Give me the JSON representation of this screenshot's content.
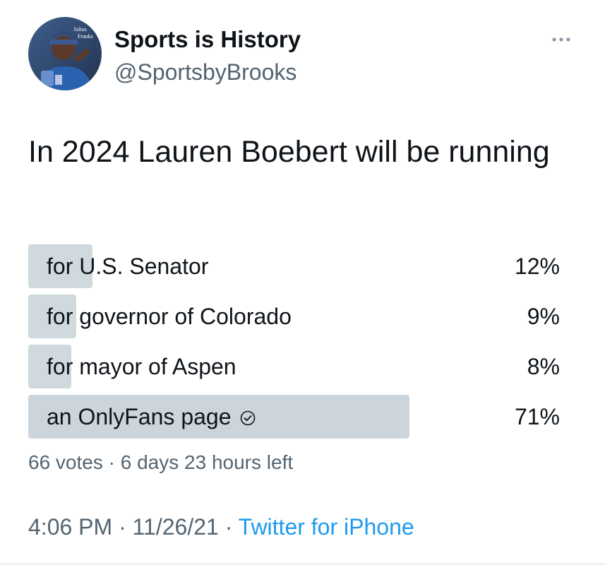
{
  "tweet": {
    "display_name": "Sports is History",
    "handle": "@SportsbyBrooks",
    "avatar_caption": "Julius Franks",
    "text": "In 2024 Lauren Boebert will be running",
    "more_icon": "ellipsis-icon"
  },
  "poll": {
    "options": [
      {
        "label": "for U.S. Senator",
        "percent_text": "12%",
        "share": 0.12,
        "winner": false
      },
      {
        "label": "for governor of Colorado",
        "percent_text": "9%",
        "share": 0.09,
        "winner": false
      },
      {
        "label": "for mayor of Aspen",
        "percent_text": "8%",
        "share": 0.08,
        "winner": false
      },
      {
        "label": "an OnlyFans page",
        "percent_text": "71%",
        "share": 0.71,
        "winner": true,
        "icon": "check-circle-icon"
      }
    ],
    "votes": "66 votes",
    "separator": " · ",
    "time_left": "6 days 23 hours left"
  },
  "meta": {
    "time": "4:06 PM",
    "date": "11/26/21",
    "separator": " · ",
    "source": "Twitter for iPhone"
  },
  "colors": {
    "text": "#0f1419",
    "secondary": "#536471",
    "link": "#1d9bf0",
    "poll_bar": "#cfd9de"
  }
}
